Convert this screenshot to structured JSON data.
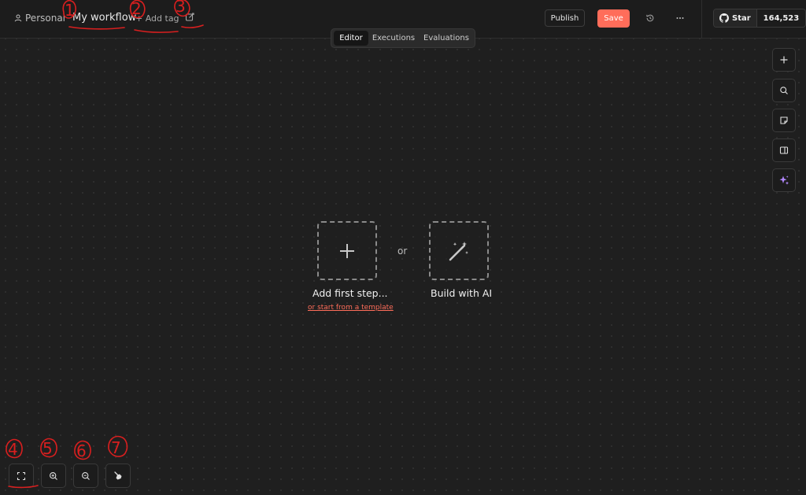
{
  "header": {
    "project_label": "Personal",
    "workflow_name": "My workflow",
    "add_tag_label": "+ Add tag",
    "publish_label": "Publish",
    "save_label": "Save"
  },
  "tabs": [
    {
      "label": "Editor",
      "active": true
    },
    {
      "label": "Executions",
      "active": false
    },
    {
      "label": "Evaluations",
      "active": false
    }
  ],
  "github": {
    "star_label": "Star",
    "star_count": "164,523"
  },
  "right_toolbar": [
    {
      "icon": "plus-icon"
    },
    {
      "icon": "search-icon"
    },
    {
      "icon": "sticky-note-icon"
    },
    {
      "icon": "panel-icon"
    },
    {
      "icon": "sparkles-icon"
    }
  ],
  "canvas": {
    "add_first_step_label": "Add first step...",
    "or_label": "or",
    "build_with_ai_label": "Build with AI",
    "template_link_label": "or start from a template"
  },
  "bottom_controls": [
    {
      "icon": "fit-view-icon"
    },
    {
      "icon": "zoom-in-icon"
    },
    {
      "icon": "zoom-out-icon"
    },
    {
      "icon": "tidy-up-icon"
    }
  ],
  "annotations": [
    "1",
    "2",
    "3",
    "4",
    "5",
    "6",
    "7"
  ],
  "colors": {
    "accent": "#ff6d5a",
    "annotation": "#d81f1f",
    "ai_purple": "#b388ff"
  }
}
